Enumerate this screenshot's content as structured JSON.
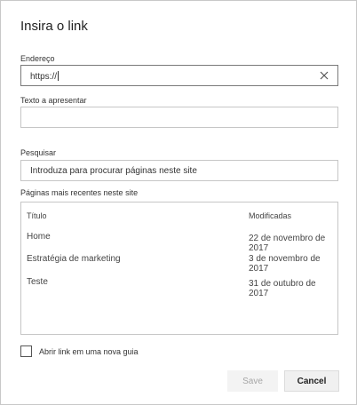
{
  "dialog": {
    "title": "Insira o link",
    "address": {
      "label": "Endereço",
      "value": "https://"
    },
    "display_text": {
      "label": "Texto a apresentar",
      "value": ""
    },
    "search": {
      "label": "Pesquisar",
      "placeholder": "Introduza para procurar páginas neste site"
    },
    "recent": {
      "label": "Páginas mais recentes neste site",
      "columns": [
        "Título",
        "Modificadas"
      ],
      "rows": [
        {
          "title": "Home",
          "modified": "22 de novembro de 2017"
        },
        {
          "title": "Estratégia de marketing",
          "modified": "3 de novembro de 2017"
        },
        {
          "title": "Teste",
          "modified": "31 de outubro de 2017"
        }
      ]
    },
    "new_tab": {
      "label": "Abrir link em uma nova guia",
      "checked": false
    },
    "buttons": {
      "save": "Save",
      "cancel": "Cancel"
    }
  }
}
